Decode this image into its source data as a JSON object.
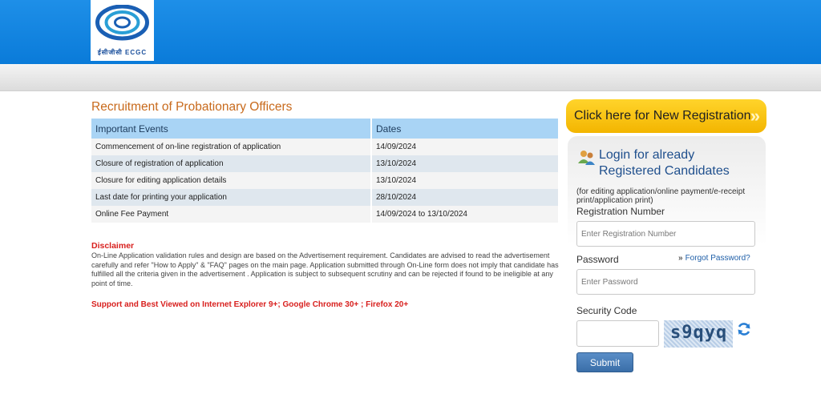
{
  "header": {
    "logo_text": "ईसीजीसी ECGC"
  },
  "page_title": "Recruitment of Probationary Officers",
  "events_table": {
    "headers": [
      "Important Events",
      "Dates"
    ],
    "rows": [
      {
        "event": "Commencement of on-line registration of application",
        "date": "14/09/2024"
      },
      {
        "event": "Closure of registration of application",
        "date": "13/10/2024"
      },
      {
        "event": "Closure for editing application details",
        "date": "13/10/2024"
      },
      {
        "event": "Last date for printing your application",
        "date": "28/10/2024"
      },
      {
        "event": "Online Fee Payment",
        "date": "14/09/2024 to 13/10/2024"
      }
    ]
  },
  "disclaimer": {
    "title": "Disclaimer",
    "text": "On-Line Application validation rules and design are based on the Advertisement requirement. Candidates are advised to read the advertisement carefully and refer \"How to Apply\" & \"FAQ\" pages on the main page. Application submitted through On-Line form does not imply that candidate has fulfilled all the criteria given in the advertisement . Application is subject to subsequent scrutiny and can be rejected if found to be ineligible at any point of time."
  },
  "browser_note": "Support and Best Viewed on Internet Explorer 9+; Google Chrome 30+ ; Firefox 20+",
  "new_registration": {
    "label": "Click here for New Registration"
  },
  "login": {
    "heading_line1": "Login for already",
    "heading_line2": "Registered Candidates",
    "note": "(for editing application/online payment/e-receipt print/application print)",
    "registration_label": "Registration Number",
    "registration_placeholder": "Enter Registration Number",
    "password_label": "Password",
    "password_placeholder": "Enter Password",
    "forgot_label": "Forgot Password?",
    "security_label": "Security Code",
    "captcha_text": "s9qyq",
    "submit_label": "Submit"
  },
  "colors": {
    "header_blue": "#0a7bd9",
    "title_orange": "#c86a1c",
    "disclaimer_red": "#d8201e",
    "registration_yellow": "#f3b500",
    "submit_blue": "#3a6ea8"
  }
}
